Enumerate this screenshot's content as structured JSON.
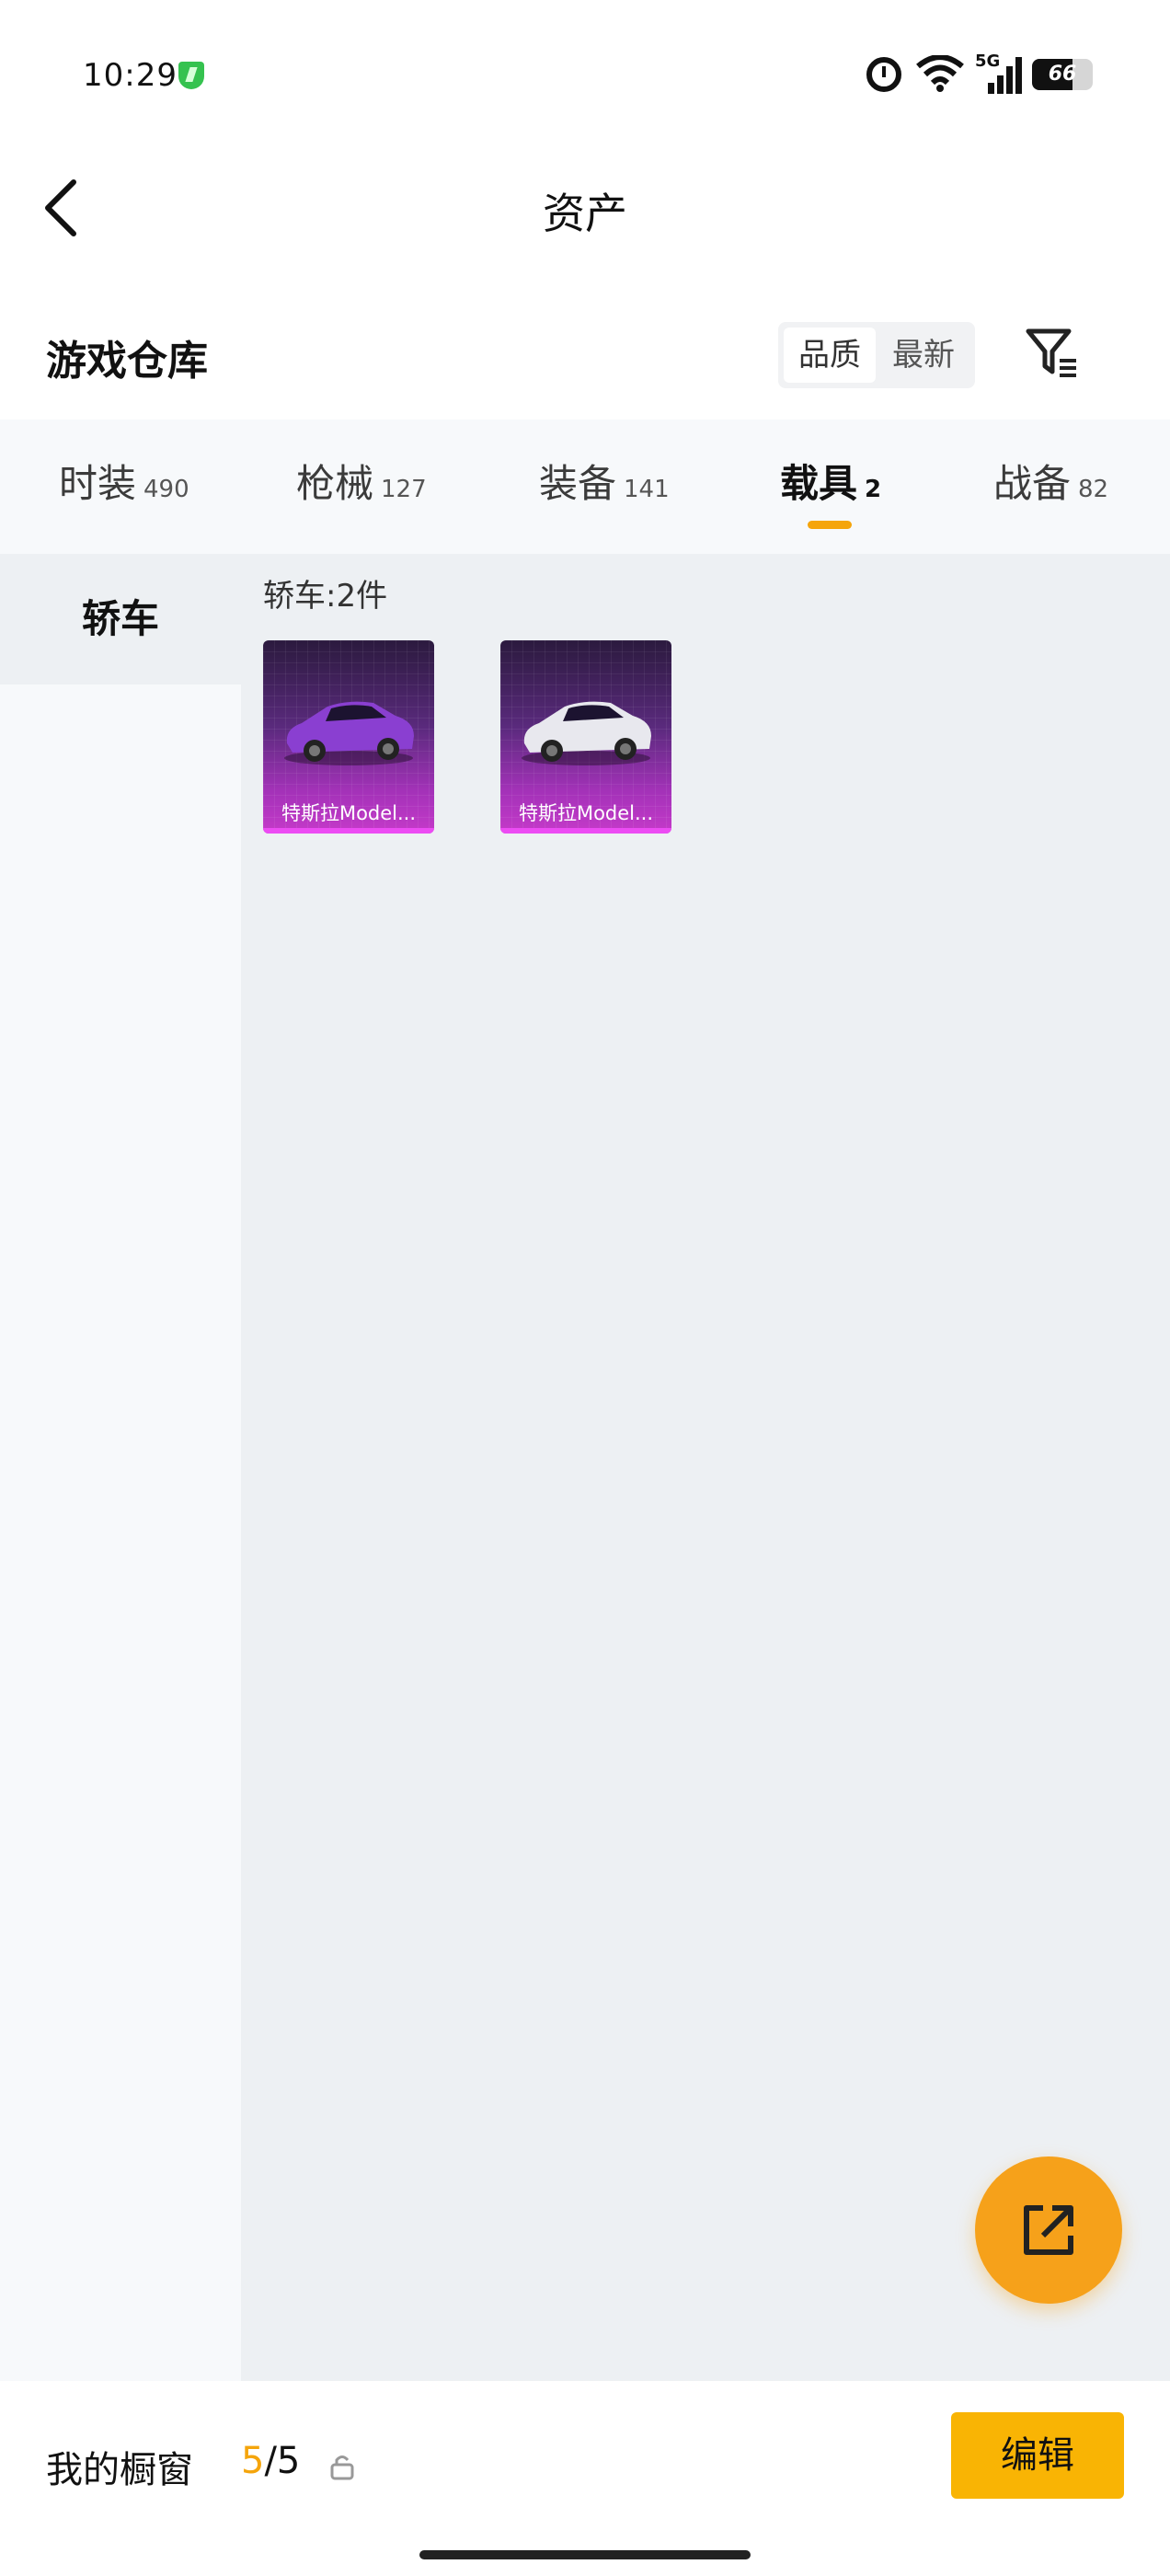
{
  "status_bar": {
    "time": "10:29",
    "network": "5G",
    "battery": "66",
    "battery_level": 0.66
  },
  "header": {
    "title": "资产"
  },
  "section": {
    "title": "游戏仓库"
  },
  "sort": {
    "options": [
      "品质",
      "最新"
    ],
    "selected": "品质"
  },
  "tabs": [
    {
      "label": "时装",
      "count": "490"
    },
    {
      "label": "枪械",
      "count": "127"
    },
    {
      "label": "装备",
      "count": "141"
    },
    {
      "label": "载具",
      "count": "2",
      "active": true
    },
    {
      "label": "战备",
      "count": "82"
    }
  ],
  "sidebar": {
    "items": [
      {
        "label": "轿车",
        "active": true
      }
    ]
  },
  "content": {
    "group_label": "轿车:2件",
    "cards": [
      {
        "name": "特斯拉Model...",
        "car_color": "#8a3fd1"
      },
      {
        "name": "特斯拉Model...",
        "car_color": "#e8e8ee"
      }
    ]
  },
  "showcase": {
    "label": "我的橱窗",
    "current": "5",
    "total": "/5"
  },
  "edit_button": {
    "label": "编辑"
  },
  "colors": {
    "accent": "#f5a50c",
    "button": "#f9b404",
    "card_glow": "#ec4cf3"
  }
}
